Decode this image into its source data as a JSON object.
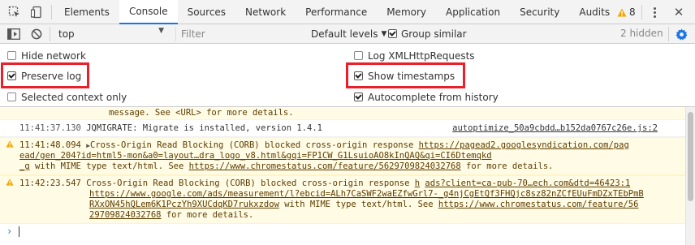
{
  "tabbar": {
    "tabs": [
      "Elements",
      "Console",
      "Sources",
      "Network",
      "Performance",
      "Memory",
      "Application",
      "Security",
      "Audits"
    ],
    "active_tab": "Console",
    "warning_count": "8"
  },
  "toolbar": {
    "context": "top",
    "filter_placeholder": "Filter",
    "levels_label": "Default levels",
    "group_similar_label": "Group similar",
    "group_similar_checked": true,
    "hidden_label": "2 hidden"
  },
  "settings": {
    "left": [
      {
        "label": "Hide network",
        "checked": false
      },
      {
        "label": "Preserve log",
        "checked": true,
        "highlighted": true
      },
      {
        "label": "Selected context only",
        "checked": false
      }
    ],
    "right": [
      {
        "label": "Log XMLHttpRequests",
        "checked": false
      },
      {
        "label": "Show timestamps",
        "checked": true,
        "highlighted": true
      },
      {
        "label": "Autocomplete from history",
        "checked": true
      }
    ]
  },
  "messages": [
    {
      "kind": "continuation",
      "text": "message. See <URL> for more details."
    },
    {
      "kind": "log",
      "timestamp": "11:41:37.130",
      "text": "JQMIGRATE: Migrate is installed, version 1.4.1",
      "source": "autoptimize_50a9cbdd…b152da0767c26e.js:2"
    },
    {
      "kind": "warning",
      "timestamp": "11:41:48.094",
      "prefix": "Cross-Origin Read Blocking (CORB) blocked cross-origin response ",
      "link1": "https://pagead2.googlesyndication.com/pag",
      "link2": "ead/gen_204?id=html5-mon&a0=layout…dra_logo_v8.html&gqi=FP1CW_G1LsuioAO8kInQAQ&qi=CI6Dtemqkd",
      "link3": "_g",
      "mid": " with MIME type text/html. See ",
      "link4": "https://www.chromestatus.com/feature/5629709824032768",
      "suffix": " for more details."
    },
    {
      "kind": "warning",
      "timestamp": "11:42:23.547",
      "prefix": "Cross-Origin Read Blocking (CORB) blocked cross-origin response ",
      "link1": "h",
      "link1b": "ads?client=ca-pub-70…ech.com&dtd=46423:1",
      "link2": "https://www.google.com/ads/measurement/l?ebcid=ALh7CaSWF2waEZfwGrl7-_g4njCgEtQf3FHQjc8sz82nZCfEUuFmDZxTEbPmB",
      "link3": "RXxON45hQLem6K1PczYh9XUCdqKD7rukxzdow",
      "mid": " with MIME type text/html. See ",
      "link4": "https://www.chromestatus.com/feature/56",
      "link5": "29709824032768",
      "suffix": " for more details."
    }
  ],
  "colors": {
    "accent": "#1a73e8",
    "warning_bg": "#fffbe5",
    "highlight": "#e8202a"
  }
}
